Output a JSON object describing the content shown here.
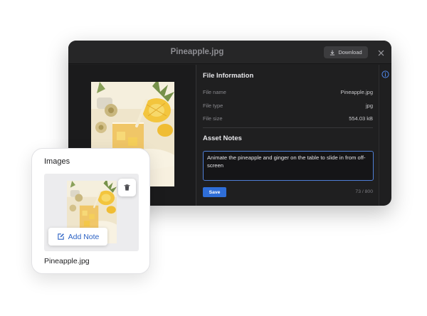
{
  "modal": {
    "title": "Pineapple.jpg",
    "download_label": "Download",
    "file_information": {
      "heading": "File Information",
      "rows": [
        {
          "label": "File name",
          "value": "Pineapple.jpg"
        },
        {
          "label": "File type",
          "value": "jpg"
        },
        {
          "label": "File size",
          "value": "554.03 kB"
        }
      ]
    },
    "asset_notes": {
      "heading": "Asset Notes",
      "value": "Animate the pineapple and ginger on the table to slide in from off-screen",
      "save_label": "Save",
      "char_count": "73 / 800"
    }
  },
  "card": {
    "title": "Images",
    "add_note_label": "Add Note",
    "filename": "Pineapple.jpg"
  },
  "icons": {
    "download": "download-icon",
    "close": "close-icon",
    "info": "info-icon",
    "trash": "trash-icon",
    "edit": "edit-icon"
  },
  "colors": {
    "modal_bg": "#1f1f20",
    "accent": "#2f6ed8",
    "link": "#2c62c4"
  }
}
